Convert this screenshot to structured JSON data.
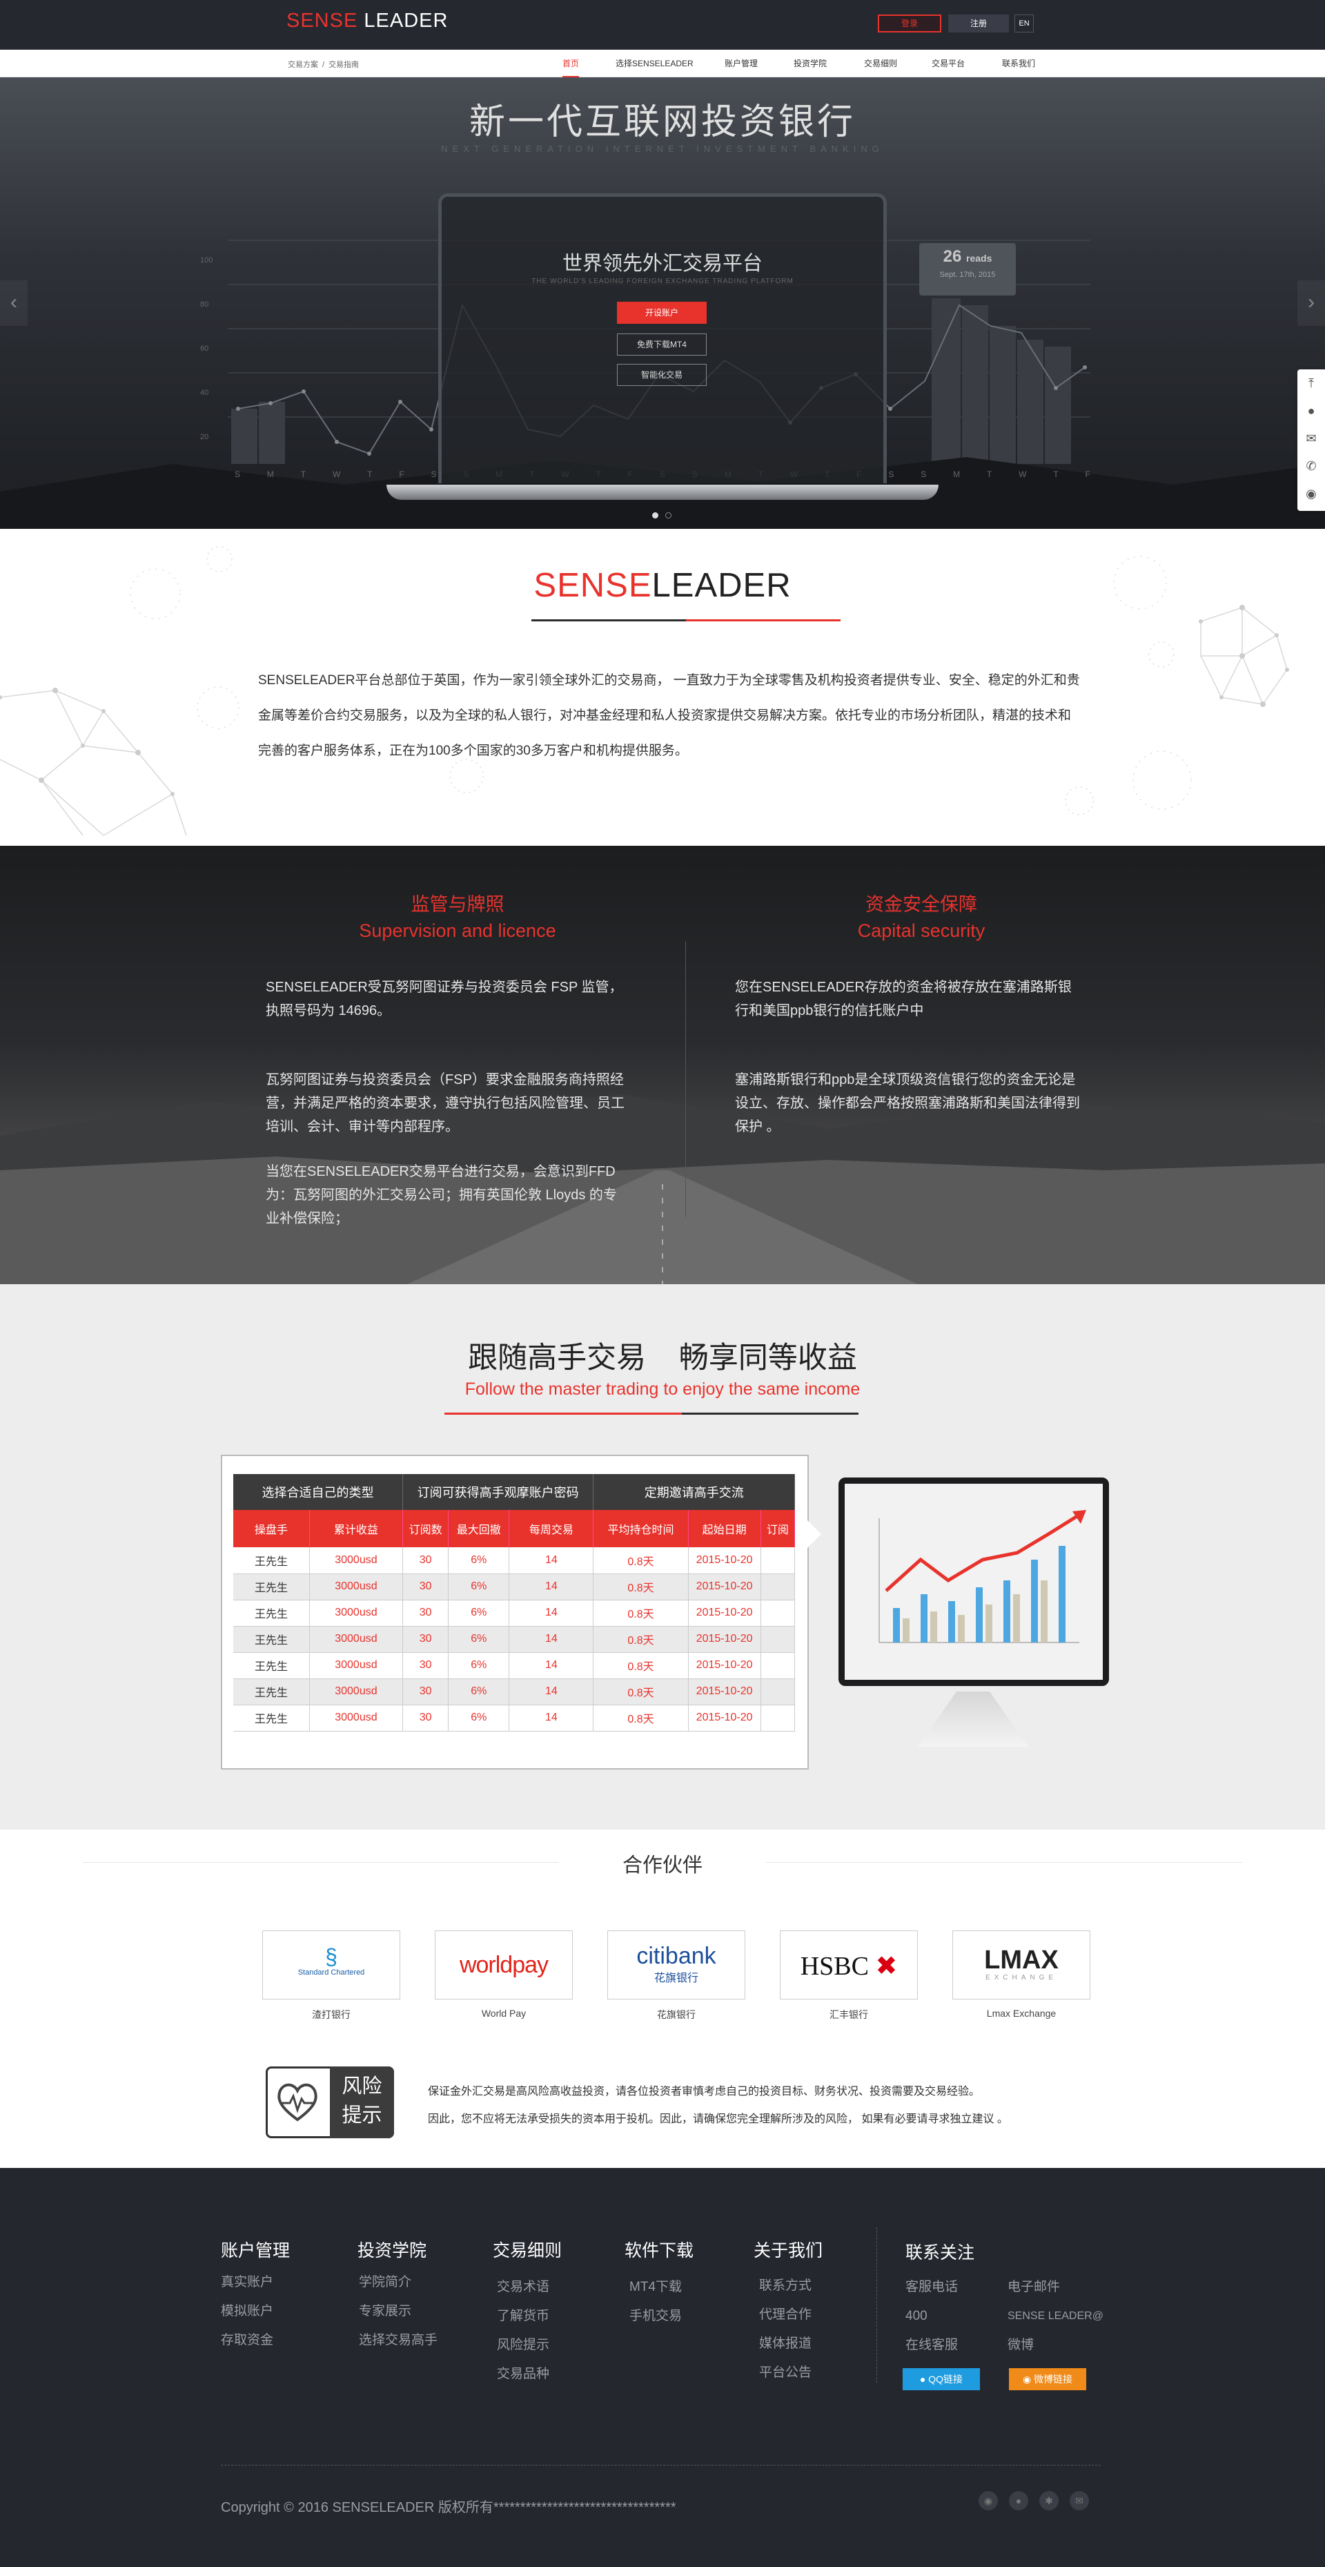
{
  "brand": {
    "red": "SENSE",
    "white": " LEADER"
  },
  "colors": {
    "accent": "#e8332d",
    "dark": "#262830",
    "footer": "#25272f"
  },
  "header": {
    "login": "登录",
    "register": "注册",
    "lang": "EN"
  },
  "breadcrumb": [
    "交易方案",
    "/",
    "交易指南"
  ],
  "nav": [
    "首页",
    "选择SENSELEADER",
    "账户管理",
    "投资学院",
    "交易细则",
    "交易平台",
    "联系我们"
  ],
  "hero": {
    "title": "新一代互联网投资银行",
    "subtitle": "NEXT GENERATION INTERNET INVESTMENT BANKING",
    "screen_title": "世界领先外汇交易平台",
    "screen_subtitle": "THE WORLD'S LEADING FOREIGN EXCHANGE TRADING PLATFORM",
    "btn_open": "开设账户",
    "btn_mt4": "免费下载MT4",
    "btn_smart": "智能化交易",
    "stat_number": "26",
    "stat_unit": "reads",
    "stat_date": "Sept. 17th, 2015",
    "chart_yticks": [
      "100",
      "80",
      "60",
      "40",
      "20"
    ],
    "chart_days": [
      "S",
      "M",
      "T",
      "W",
      "T",
      "F",
      "S",
      "S",
      "M",
      "T",
      "W",
      "T",
      "F",
      "S",
      "S",
      "M",
      "T",
      "W",
      "T",
      "F",
      "S",
      "S",
      "M",
      "T",
      "W",
      "T",
      "F"
    ]
  },
  "about": {
    "title_red": "SENSE",
    "title_dark": "LEADER",
    "text": "SENSELEADER平台总部位于英国，作为一家引领全球外汇的交易商， 一直致力于为全球零售及机构投资者提供专业、安全、稳定的外汇和贵金属等差价合约交易服务，以及为全球的私人银行，对冲基金经理和私人投资家提供交易解决方案。依托专业的市场分析团队，精湛的技术和完善的客户服务体系，正在为100多个国家的30多万客户和机构提供服务。"
  },
  "security": {
    "left_title_cn": "监管与牌照",
    "left_title_en": "Supervision and licence",
    "left_p1": "SENSELEADER受瓦努阿图证券与投资委员会 FSP 监管，执照号码为 14696。",
    "left_p2": "瓦努阿图证券与投资委员会（FSP）要求金融服务商持照经营，并满足严格的资本要求，遵守执行包括风险管理、员工培训、会计、审计等内部程序。",
    "left_p3": "当您在SENSELEADER交易平台进行交易，会意识到FFD为：瓦努阿图的外汇交易公司；拥有英国伦敦 Lloyds 的专业补偿保险；",
    "right_title_cn": "资金安全保障",
    "right_title_en": "Capital security",
    "right_p1": "您在SENSELEADER存放的资金将被存放在塞浦路斯银行和美国ppb银行的信托账户中",
    "right_p2": "塞浦路斯银行和ppb是全球顶级资信银行您的资金无论是设立、存放、操作都会严格按照塞浦路斯和美国法律得到保护 。"
  },
  "follow": {
    "title": "跟随高手交易    畅享同等收益",
    "subtitle": "Follow the master trading to enjoy the same income",
    "group_headers": [
      "选择合适自己的类型",
      "订阅可获得高手观摩账户密码",
      "定期邀请高手交流"
    ],
    "columns": [
      "操盘手",
      "累计收益",
      "订阅数",
      "最大回撤",
      "每周交易",
      "平均持仓时间",
      "起始日期",
      "订阅"
    ],
    "rows": [
      [
        "王先生",
        "3000usd",
        "30",
        "6%",
        "14",
        "0.8天",
        "2015-10-20",
        ""
      ],
      [
        "王先生",
        "3000usd",
        "30",
        "6%",
        "14",
        "0.8天",
        "2015-10-20",
        ""
      ],
      [
        "王先生",
        "3000usd",
        "30",
        "6%",
        "14",
        "0.8天",
        "2015-10-20",
        ""
      ],
      [
        "王先生",
        "3000usd",
        "30",
        "6%",
        "14",
        "0.8天",
        "2015-10-20",
        ""
      ],
      [
        "王先生",
        "3000usd",
        "30",
        "6%",
        "14",
        "0.8天",
        "2015-10-20",
        ""
      ],
      [
        "王先生",
        "3000usd",
        "30",
        "6%",
        "14",
        "0.8天",
        "2015-10-20",
        ""
      ],
      [
        "王先生",
        "3000usd",
        "30",
        "6%",
        "14",
        "0.8天",
        "2015-10-20",
        ""
      ]
    ]
  },
  "partners": {
    "title": "合作伙伴",
    "items": [
      {
        "logo": "Standard Chartered",
        "label": "渣打银行"
      },
      {
        "logo": "worldpay",
        "label": "World Pay"
      },
      {
        "logo": "citibank",
        "logo_cn": "花旗银行",
        "label": "花旗银行"
      },
      {
        "logo": "HSBC",
        "label": "汇丰银行"
      },
      {
        "logo": "LMAX",
        "logo_sub": "EXCHANGE",
        "label": "Lmax Exchange"
      }
    ]
  },
  "risk": {
    "badge_line1": "风险",
    "badge_line2": "提示",
    "line1": "保证金外汇交易是高风险高收益投资，请各位投资者审慎考虑自己的投资目标、财务状况、投资需要及交易经验。",
    "line2": "因此，您不应将无法承受损失的资本用于投机。因此，请确保您完全理解所涉及的风险， 如果有必要请寻求独立建议 。"
  },
  "footer": {
    "cols": [
      {
        "title": "账户管理",
        "items": [
          "真实账户",
          "模拟账户",
          "存取资金"
        ]
      },
      {
        "title": "投资学院",
        "items": [
          "学院简介",
          "专家展示",
          "选择交易高手"
        ]
      },
      {
        "title": "交易细则",
        "items": [
          "交易术语",
          "了解货币",
          "风险提示",
          "交易品种"
        ]
      },
      {
        "title": "软件下载",
        "items": [
          "MT4下载",
          "手机交易"
        ]
      },
      {
        "title": "关于我们",
        "items": [
          "联系方式",
          "代理合作",
          "媒体报道",
          "平台公告"
        ]
      }
    ],
    "contact_title": "联系关注",
    "contact_left": [
      "客服电话",
      "400",
      "在线客服"
    ],
    "contact_right": [
      "电子邮件",
      "SENSE LEADER@",
      "微博"
    ],
    "qq_btn": "QQ链接",
    "weibo_btn": "微博链接",
    "copyright": "Copyright © 2016 SENSELEADER 版权所有**********************************"
  },
  "side_tools": [
    "top-icon",
    "qq-icon",
    "mail-icon",
    "phone-icon",
    "wechat-icon"
  ]
}
